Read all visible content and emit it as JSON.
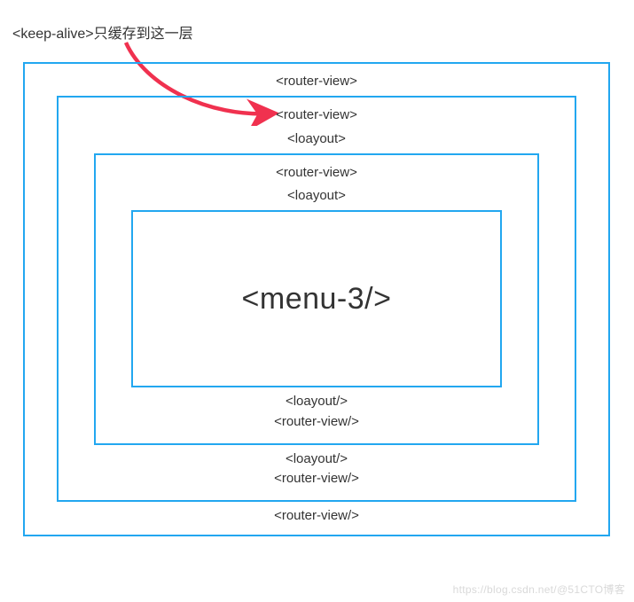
{
  "caption": "<keep-alive>只缓存到这一层",
  "levels": {
    "l1": {
      "top": "<router-view>",
      "bottom": "<router-view/>"
    },
    "l2": {
      "top1": "<router-view>",
      "top2": "<loayout>",
      "bottom1": "<loayout/>",
      "bottom2": "<router-view/>"
    },
    "l3": {
      "top1": "<router-view>",
      "top2": "<loayout>",
      "bottom1": "<loayout/>",
      "bottom2": "<router-view/>"
    },
    "l4": {
      "content": "<menu-3/>"
    }
  },
  "watermark": "https://blog.csdn.net/@51CTO博客"
}
